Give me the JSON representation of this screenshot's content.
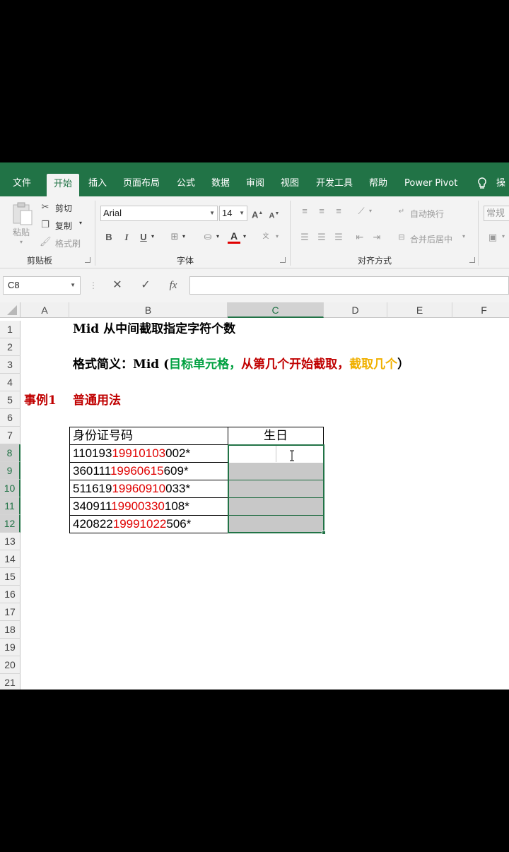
{
  "ribbon": {
    "tabs": [
      "文件",
      "开始",
      "插入",
      "页面布局",
      "公式",
      "数据",
      "审阅",
      "视图",
      "开发工具",
      "帮助",
      "Power Pivot",
      "操"
    ],
    "active_tab": "开始",
    "clipboard": {
      "paste": "粘贴",
      "cut": "剪切",
      "copy": "复制",
      "format_painter": "格式刷",
      "label": "剪贴板"
    },
    "font": {
      "name": "Arial",
      "size": "14",
      "bold": "B",
      "italic": "I",
      "underline": "U",
      "font_color": "A",
      "label": "字体"
    },
    "alignment": {
      "wrap": "自动换行",
      "merge": "合并后居中",
      "label": "对齐方式"
    },
    "number": {
      "format": "常规"
    }
  },
  "formula_bar": {
    "name_box": "C8",
    "cancel": "✕",
    "enter": "✓",
    "fx": "fx",
    "content": ""
  },
  "sheet": {
    "columns": [
      "A",
      "B",
      "C",
      "D",
      "E",
      "F"
    ],
    "rows": [
      "1",
      "2",
      "3",
      "4",
      "5",
      "6",
      "7",
      "8",
      "9",
      "10",
      "11",
      "12",
      "13",
      "14",
      "15",
      "16",
      "17",
      "18",
      "19",
      "20",
      "21"
    ],
    "row1": {
      "b": "Mid  从中间截取指定字符个数"
    },
    "row3": {
      "prefix": "格式简义：Mid (",
      "arg1": "目标单元格，",
      "arg2": "从第几个开始截取，",
      "arg3": "截取几个",
      "suffix": "）"
    },
    "row5": {
      "a": "事例1",
      "b": "普通用法"
    },
    "table": {
      "header_id": "身份证号码",
      "header_birthday": "生日",
      "rows": [
        {
          "pre": "110193",
          "mid": "19910103",
          "post": "002*"
        },
        {
          "pre": "360111",
          "mid": "19960615",
          "post": "609*"
        },
        {
          "pre": "511619",
          "mid": "19960910",
          "post": "033*"
        },
        {
          "pre": "340911",
          "mid": "19900330",
          "post": "108*"
        },
        {
          "pre": "420822",
          "mid": "19991022",
          "post": "506*"
        }
      ]
    }
  },
  "colors": {
    "excel_green": "#217346",
    "highlight_red": "#e00000",
    "green_text": "#00a040",
    "gold_text": "#f0b000"
  }
}
